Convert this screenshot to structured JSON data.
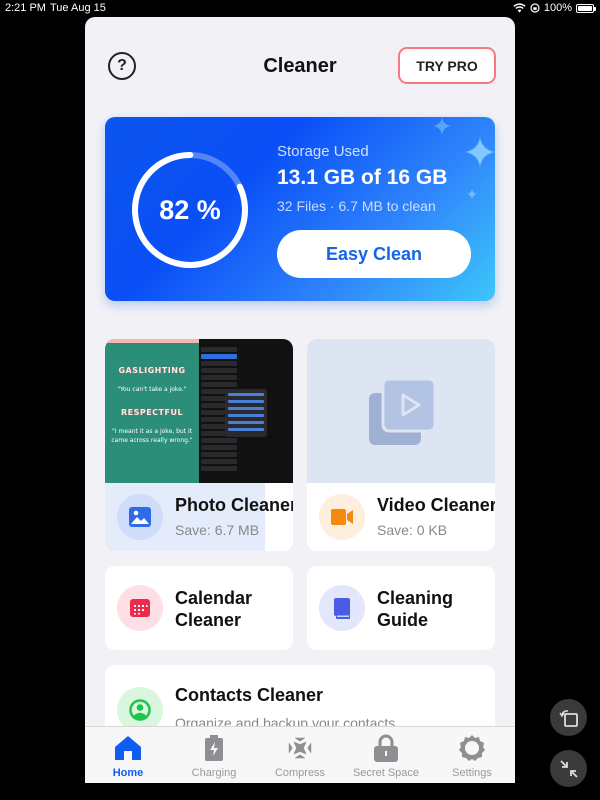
{
  "status_bar": {
    "time": "2:21 PM",
    "date": "Tue Aug 15",
    "battery_text": "100%",
    "icons": [
      "wifi-icon",
      "orientation-lock-icon",
      "battery-icon"
    ]
  },
  "header": {
    "title": "Cleaner",
    "help_icon": "question-circle-icon",
    "pro_button": "TRY PRO",
    "pro_border_color": "#f7787f"
  },
  "storage": {
    "percent_label": "82 %",
    "percent_value": 0.82,
    "label": "Storage Used",
    "value": "13.1 GB of 16 GB",
    "sub": "32 Files · 6.7 MB to clean",
    "clean_button": "Easy Clean",
    "accent": "#1565e8"
  },
  "tiles": {
    "photo": {
      "title": "Photo Cleaner",
      "sub": "Save: 6.7 MB",
      "icon": "image-icon",
      "icon_color": "#2f6ae8",
      "thumb_text": {
        "h1": "GASLIGHTING",
        "q1": "\"You can't take a joke.\"",
        "h2": "RESPECTFUL",
        "q2": "\"I meant it as a joke, but it came across really wrong.\""
      }
    },
    "video": {
      "title": "Video Cleaner",
      "sub": "Save: 0 KB",
      "icon": "video-camera-icon",
      "icon_color": "#f58a0f"
    },
    "calendar": {
      "title_line1": "Calendar",
      "title_line2": "Cleaner",
      "icon": "calendar-icon",
      "icon_color": "#ec2b4d"
    },
    "guide": {
      "title_line1": "Cleaning",
      "title_line2": "Guide",
      "icon": "book-icon",
      "icon_color": "#4a5be8"
    },
    "contacts": {
      "title": "Contacts Cleaner",
      "sub": "Organize and backup your contacts",
      "icon": "contact-icon",
      "icon_color": "#1fc24a"
    }
  },
  "tabbar": {
    "items": [
      {
        "label": "Home",
        "icon": "home-icon",
        "active": true
      },
      {
        "label": "Charging",
        "icon": "battery-charging-icon",
        "active": false
      },
      {
        "label": "Compress",
        "icon": "compress-icon",
        "active": false
      },
      {
        "label": "Secret Space",
        "icon": "lock-icon",
        "active": false
      },
      {
        "label": "Settings",
        "icon": "gear-icon",
        "active": false
      }
    ],
    "active_color": "#0f5df2"
  },
  "floating": {
    "rotate": "rotate-icon",
    "collapse": "collapse-icon"
  }
}
